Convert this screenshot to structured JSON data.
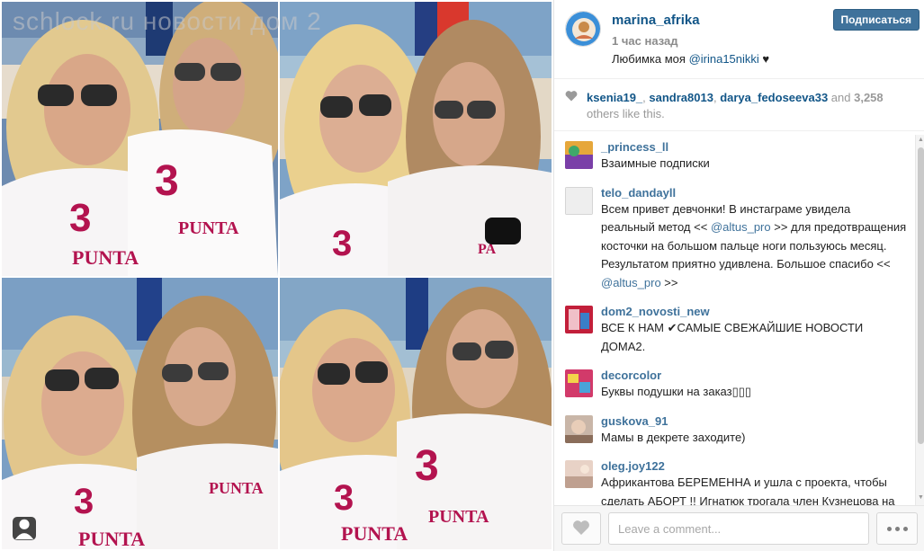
{
  "photo": {
    "watermark": "schlock.ru новости дом 2",
    "panel_icons": [
      "user-tag-icon"
    ]
  },
  "post": {
    "username": "marina_afrika",
    "time": "1 час назад",
    "caption_text": "Любимка моя ",
    "caption_mention": "@irina15nikki",
    "caption_heart": " ♥",
    "follow_label": "Подписаться",
    "avatar_label": "MARINA AFRIKA"
  },
  "likes": {
    "icon": "heart-icon",
    "user1": "ksenia19_",
    "sep1": ", ",
    "user2": "sandra8013",
    "sep2": ", ",
    "user3": "darya_fedoseeva33",
    "and": " and ",
    "count": "3,258",
    "others": " others like this."
  },
  "comments": [
    {
      "user": "_princess_ll",
      "text": "Взаимные подписки"
    },
    {
      "user": "telo_dandayll",
      "text_a": "Всем привет девчонки! В инстаграме увидела реальный метод << ",
      "link1": "@altus_pro",
      "text_b": " >> для предотвращения косточки на большом пальце ноги пользуюсь месяц. Результатом приятно удивлена. Большое спасибо << ",
      "link2": "@altus_pro",
      "text_c": " >>"
    },
    {
      "user": "dom2_novosti_new",
      "text": "ВСЕ К НАМ ✔САМЫЕ СВЕЖАЙШИЕ НОВОСТИ ДОМА2."
    },
    {
      "user": "decorcolor",
      "text": "Буквы подушки на заказ▯▯▯"
    },
    {
      "user": "guskova_91",
      "text": "Мамы в декрете заходите)"
    },
    {
      "user": "oleg.joy122",
      "text": "Африкантова БЕРЕМЕННА и ушла с проекта, чтобы сделать АБОРТ !! Игнатюк трогала член Кузнецова на камеру!! все подробности тут ▯ @..."
    }
  ],
  "footer": {
    "like_icon": "heart-icon",
    "placeholder": "Leave a comment...",
    "more_icon": "more-dots-icon"
  },
  "colors": {
    "link": "#125688",
    "comment_user": "#3f729b",
    "follow_button": "#3f729b",
    "muted": "#999999"
  }
}
